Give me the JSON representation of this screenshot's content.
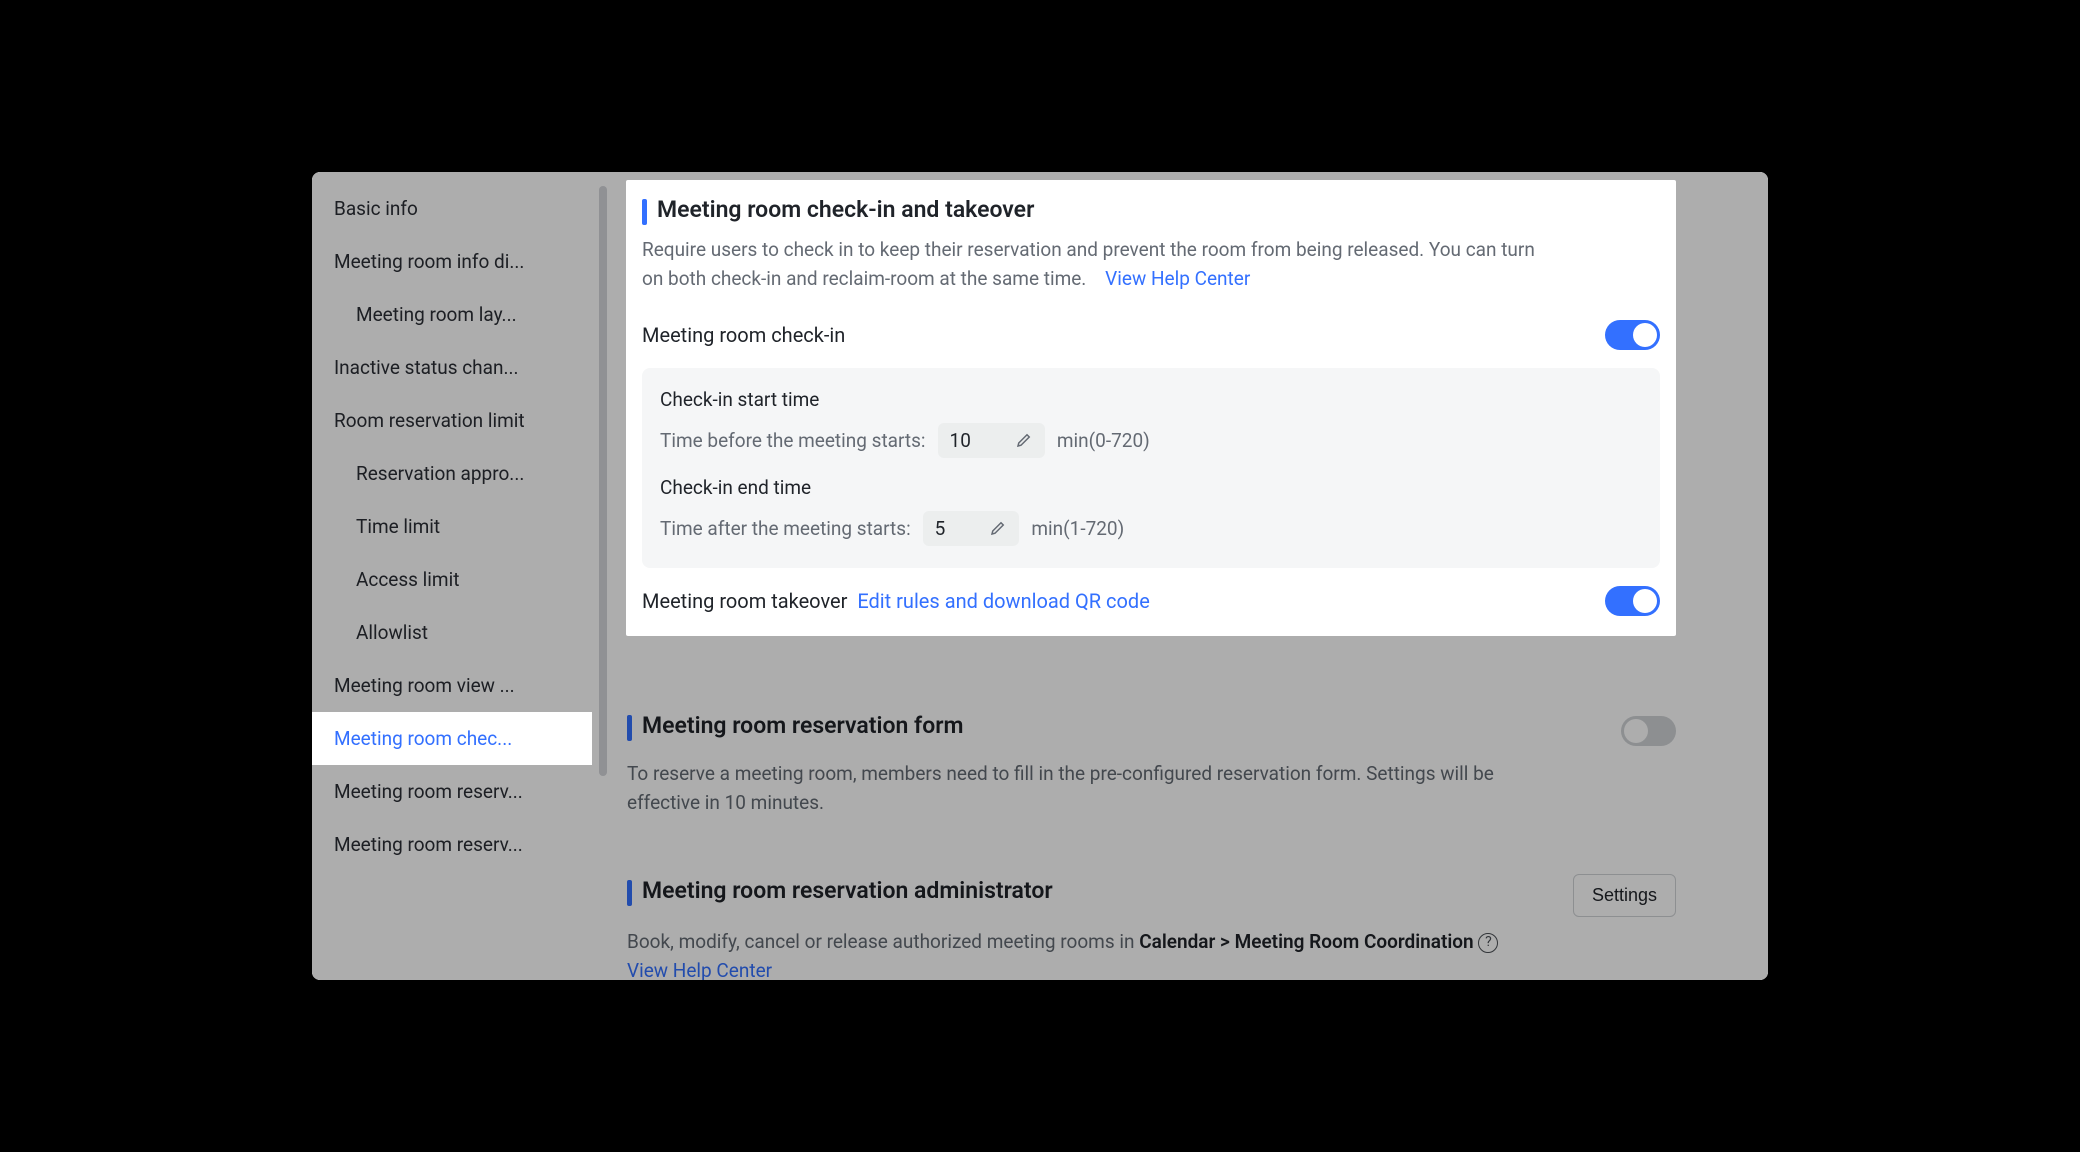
{
  "sidebar": {
    "items": [
      {
        "label": "Basic info"
      },
      {
        "label": "Meeting room info di..."
      },
      {
        "label": "Meeting room lay...",
        "sub": true
      },
      {
        "label": "Inactive status chan..."
      },
      {
        "label": "Room reservation limit"
      },
      {
        "label": "Reservation appro...",
        "sub": true
      },
      {
        "label": "Time limit",
        "sub": true
      },
      {
        "label": "Access limit",
        "sub": true
      },
      {
        "label": "Allowlist",
        "sub": true
      },
      {
        "label": "Meeting room view ..."
      },
      {
        "label": "Meeting room chec...",
        "active": true
      },
      {
        "label": "Meeting room reserv..."
      },
      {
        "label": "Meeting room reserv..."
      }
    ]
  },
  "checkin_section": {
    "title": "Meeting room check-in and takeover",
    "desc": "Require users to check in to keep their reservation and prevent the room from being released. You can turn on both check-in and reclaim-room at the same time.",
    "help_link": "View Help Center",
    "checkin_label": "Meeting room check-in",
    "checkin_on": true,
    "start_title": "Check-in start time",
    "start_prefix": "Time before the meeting starts:",
    "start_value": "10",
    "start_suffix": "min(0-720)",
    "end_title": "Check-in end time",
    "end_prefix": "Time after the meeting starts:",
    "end_value": "5",
    "end_suffix": "min(1-720)",
    "takeover_label": "Meeting room takeover",
    "takeover_link": "Edit rules and download QR code",
    "takeover_on": true
  },
  "form_section": {
    "title": "Meeting room reservation form",
    "desc": "To reserve a meeting room, members need to fill in the pre-configured reservation form. Settings will be effective in 10 minutes.",
    "on": false
  },
  "admin_section": {
    "title": "Meeting room reservation administrator",
    "desc_pre": "Book, modify, cancel or release authorized meeting rooms in ",
    "desc_bold": "Calendar > Meeting Room Coordination",
    "settings_btn": "Settings",
    "help_link": "View Help Center"
  }
}
